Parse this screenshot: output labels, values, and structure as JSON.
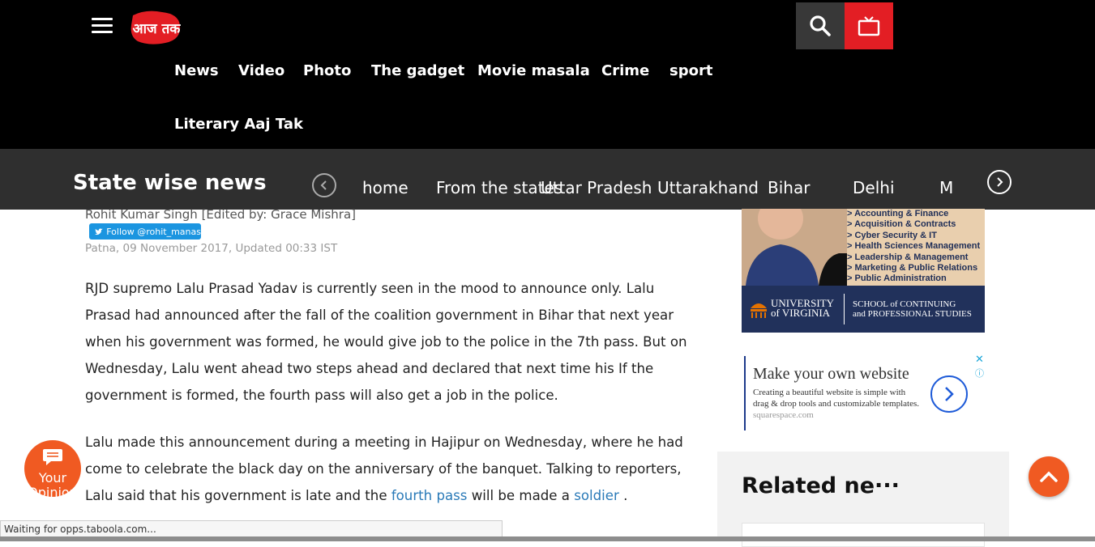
{
  "header": {
    "logo_text": "आज तक",
    "nav": [
      "News",
      "Video",
      "Photo",
      "The gadget",
      "Movie masala",
      "Crime",
      "sport",
      "Literary Aaj Tak"
    ],
    "icons": {
      "menu": "hamburger-icon",
      "search": "search-icon",
      "tv": "tv-icon"
    },
    "accent": "#e31e24"
  },
  "state_bar": {
    "title": "State wise news",
    "items": [
      "home",
      "From the states",
      "Uttar Pradesh",
      "Uttarakhand",
      "Bihar",
      "Delhi",
      "M"
    ]
  },
  "article": {
    "byline": "Rohit Kumar Singh [Edited by: Grace Mishra]",
    "follow": "Follow @rohit_manas",
    "dateline": "Patna, 09 November 2017, Updated 00:33 IST",
    "para1": "RJD supremo Lalu Prasad Yadav is currently seen in the mood to announce only. Lalu Prasad had announced after the fall of the coalition government in Bihar that next year when his government was formed, he would give job to the police in the 7th pass. But on Wednesday, Lalu went ahead two steps ahead and declared that next time his If the government is formed, the fourth pass will also get a job in the police.",
    "para2_a": "Lalu made this announcement during a meeting in Hajipur on Wednesday, where he had come to celebrate the black day on the anniversary of the banquet. Talking to reporters, Lalu said that his government is late and the ",
    "link1": "fourth pass",
    "para2_b": " will be made a ",
    "link2": "soldier",
    "para2_c": " ."
  },
  "ad1": {
    "courses": [
      "> Accounting & Finance",
      "> Acquisition & Contracts",
      "> Cyber Security & IT",
      "> Health Sciences Management",
      "> Leadership & Management",
      "> Marketing & Public Relations",
      "> Public Administration"
    ],
    "uni_line1": "UNIVERSITY",
    "uni_line2": "of VIRGINIA",
    "school_line1": "SCHOOL of CONTINUING",
    "school_line2": "and PROFESSIONAL STUDIES"
  },
  "ad2": {
    "title": "Make your own website",
    "body": "Creating a beautiful website is simple with drag & drop tools and customizable templates.",
    "domain": "squarespace.com"
  },
  "related": {
    "title": "Related ne···"
  },
  "opinion": {
    "label_line1": "Your",
    "label_line2": "Opinion"
  },
  "status": {
    "text": "Waiting for opps.taboola.com..."
  }
}
